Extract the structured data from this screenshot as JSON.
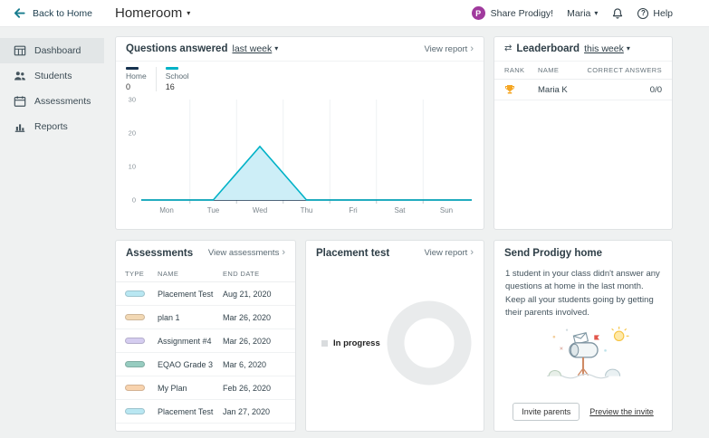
{
  "colors": {
    "accent_teal": "#00b2c7",
    "navy": "#16324f",
    "chart_fill": "#cdeef7",
    "trophy_gold": "#f5a623",
    "logo_purple": "#a03a9d"
  },
  "topbar": {
    "back_label": "Back to Home",
    "title": "Homeroom",
    "share_label": "Share Prodigy!",
    "user_name": "Maria",
    "help_label": "Help"
  },
  "sidebar": {
    "items": [
      {
        "label": "Dashboard"
      },
      {
        "label": "Students"
      },
      {
        "label": "Assessments"
      },
      {
        "label": "Reports"
      }
    ]
  },
  "questions_card": {
    "title": "Questions answered",
    "filter_label": "last week",
    "view_report_label": "View report",
    "legend": [
      {
        "name": "Home",
        "value": "0",
        "color": "#16324f"
      },
      {
        "name": "School",
        "value": "16",
        "color": "#00b2c7"
      }
    ]
  },
  "chart_data": {
    "type": "line",
    "title": "Questions answered last week",
    "x": [
      "Mon",
      "Tue",
      "Wed",
      "Thu",
      "Fri",
      "Sat",
      "Sun"
    ],
    "ylim": [
      0,
      30
    ],
    "yticks": [
      0,
      10,
      20,
      30
    ],
    "grid": "vertical-faint",
    "legend_position": "top-left",
    "series": [
      {
        "name": "Home",
        "color": "#16324f",
        "values": [
          0,
          0,
          0,
          0,
          0,
          0,
          0
        ]
      },
      {
        "name": "School",
        "color": "#00b2c7",
        "fill": "#cdeef7",
        "values": [
          0,
          0,
          16,
          0,
          0,
          0,
          0
        ]
      }
    ]
  },
  "leaderboard": {
    "title": "Leaderboard",
    "filter_label": "this week",
    "columns": [
      "RANK",
      "NAME",
      "CORRECT ANSWERS"
    ],
    "rows": [
      {
        "rank_icon": "trophy-gold",
        "name": "Maria K",
        "correct_answers": "0/0"
      }
    ]
  },
  "assessments": {
    "title": "Assessments",
    "view_label": "View assessments",
    "columns": [
      "TYPE",
      "NAME",
      "END DATE"
    ],
    "rows": [
      {
        "type_color": "#b9e7f2",
        "name": "Placement Test",
        "end_date": "Aug 21, 2020"
      },
      {
        "type_color": "#f2d8b4",
        "name": "plan 1",
        "end_date": "Mar 26, 2020"
      },
      {
        "type_color": "#d5cdf0",
        "name": "Assignment #4",
        "end_date": "Mar 26, 2020"
      },
      {
        "type_color": "#97ccc0",
        "name": "EQAO Grade 3",
        "end_date": "Mar 6, 2020"
      },
      {
        "type_color": "#f8d3ae",
        "name": "My Plan",
        "end_date": "Feb 26, 2020"
      },
      {
        "type_color": "#b9e7f2",
        "name": "Placement Test",
        "end_date": "Jan 27, 2020"
      }
    ]
  },
  "placement": {
    "title": "Placement test",
    "view_label": "View report",
    "legend_label": "In progress",
    "legend_color": "#d9dcde",
    "donut_color": "#e9ebec"
  },
  "send_home": {
    "title": "Send Prodigy home",
    "body": "1 student in your class didn't answer any questions at home in the last month. Keep all your students going by getting their parents involved.",
    "invite_button": "Invite parents",
    "preview_link": "Preview the invite"
  }
}
